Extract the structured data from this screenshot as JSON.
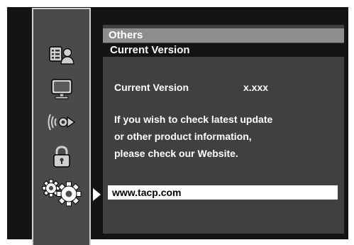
{
  "breadcrumb": {
    "level1": "Others",
    "level2": "Current Version"
  },
  "content": {
    "version_label": "Current Version",
    "version_value": "x.xxx",
    "message_line1": "If you wish to check latest update",
    "message_line2": "or other product information,",
    "message_line3": "please check our Website.",
    "website": "www.tacp.com"
  },
  "sidebar": {
    "items": [
      {
        "icon": "display-person-icon"
      },
      {
        "icon": "monitor-icon"
      },
      {
        "icon": "speaker-sound-icon"
      },
      {
        "icon": "lock-icon"
      },
      {
        "icon": "gears-icon",
        "selected": true
      }
    ]
  },
  "colors": {
    "background": "#141414",
    "sidebar": "#4a4a4a",
    "panel": "#404040",
    "breadcrumb_highlight": "#8e8e8e",
    "selected_row": "#ffffff"
  }
}
